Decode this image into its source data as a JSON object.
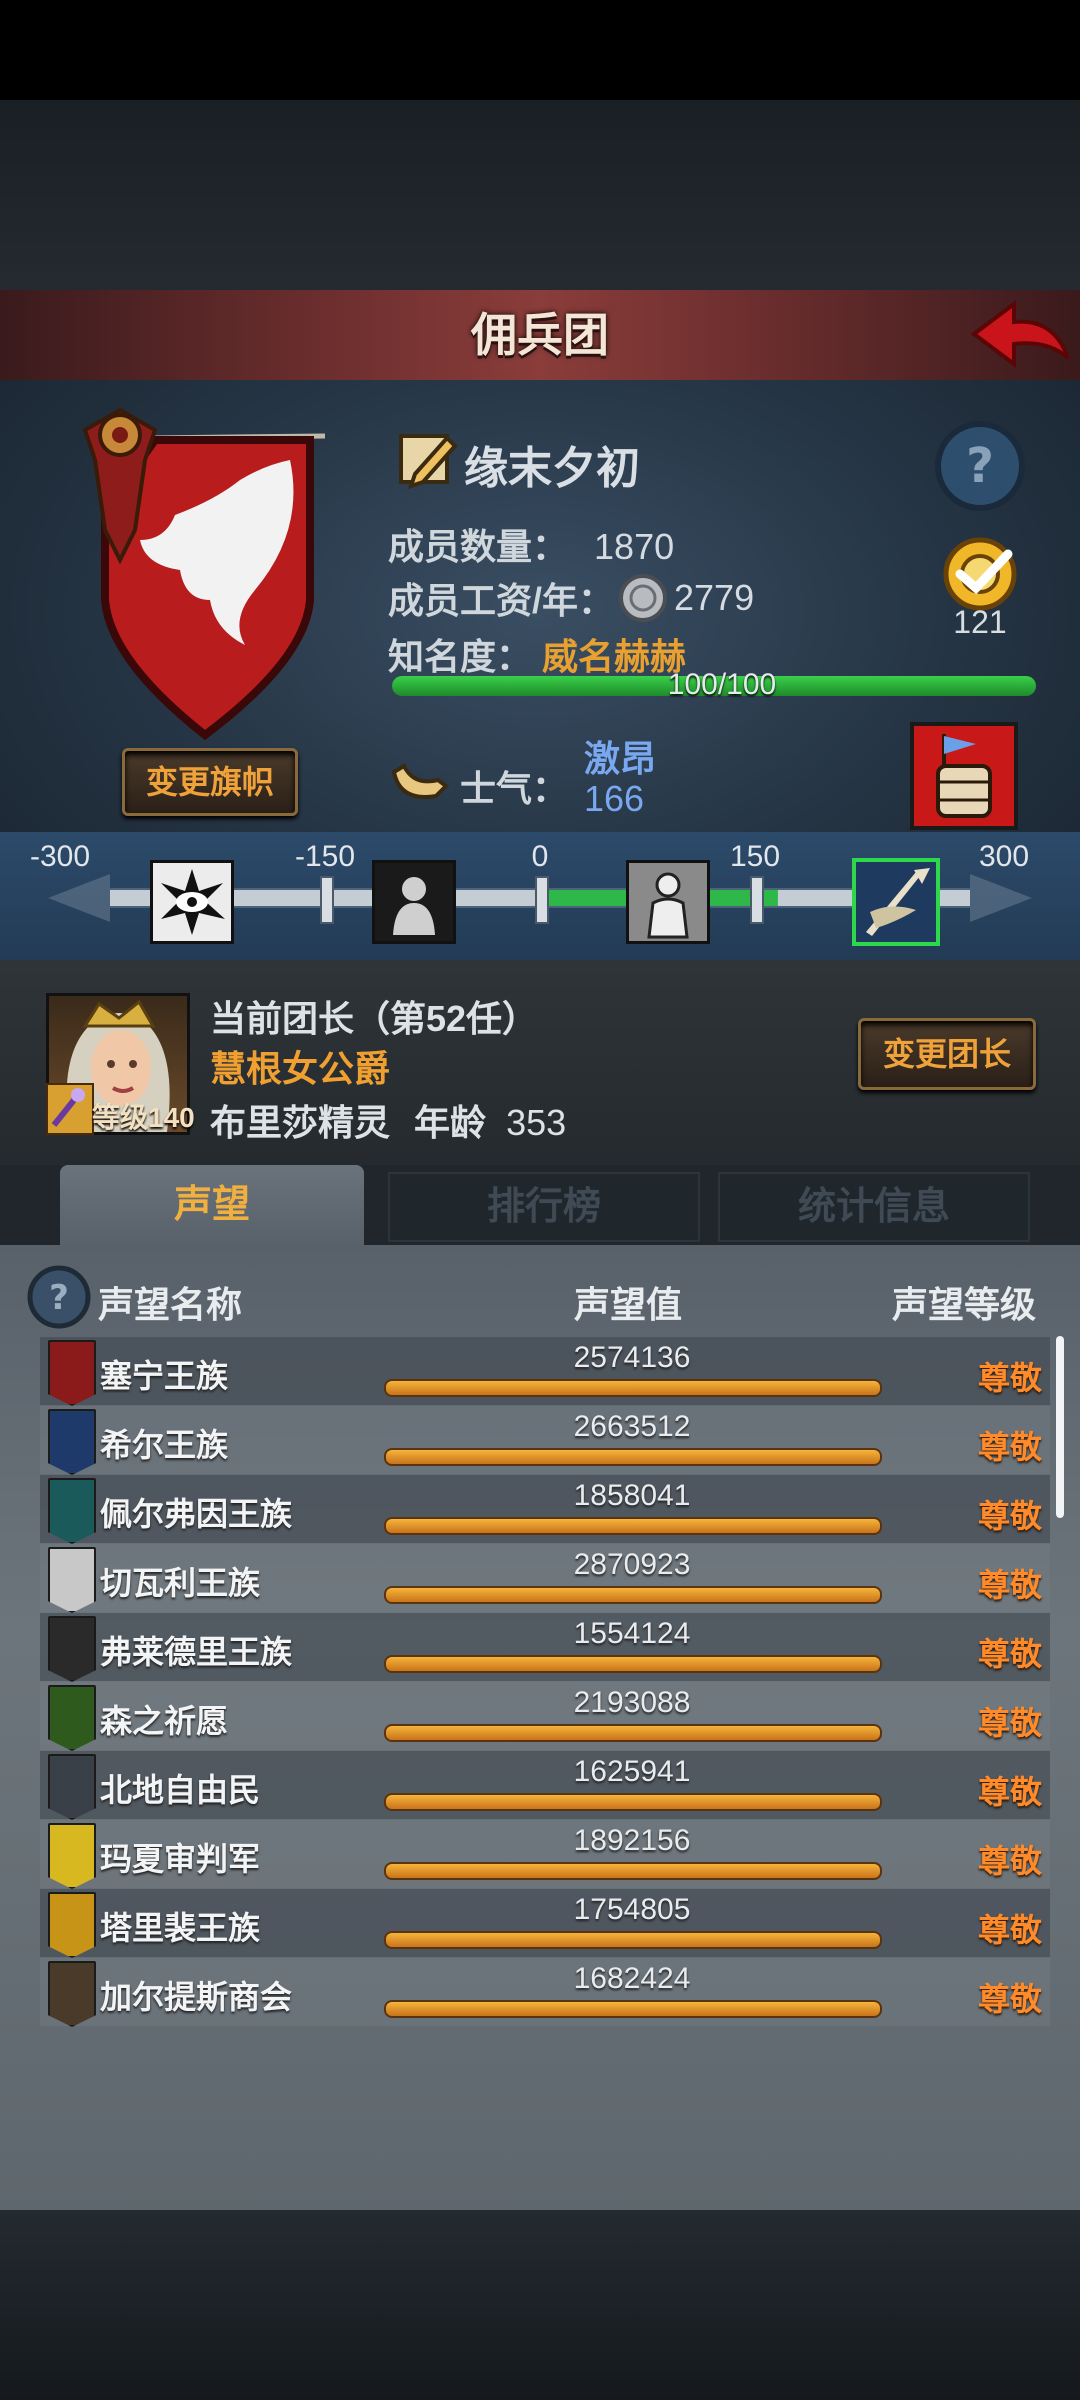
{
  "header": {
    "title": "佣兵团"
  },
  "guild": {
    "name": "缘末夕初",
    "members_label": "成员数量：",
    "members": "1870",
    "salary_label": "成员工资/年：",
    "salary": "2779",
    "fame_label": "知名度：",
    "fame_value": "威名赫赫",
    "fame_progress_text": "100/100",
    "fame_progress": 1.0,
    "badge_count": "121",
    "change_banner_label": "变更旗帜",
    "morale_label": "士气：",
    "morale_status": "激昂",
    "morale_value": "166"
  },
  "morale_scale": {
    "ticks": [
      "-300",
      "-150",
      "0",
      "150",
      "300"
    ],
    "min": -300,
    "max": 300,
    "value": 166
  },
  "leader": {
    "title": "当前团长（第52任）",
    "name": "慧根女公爵",
    "level_label": "等级",
    "level": "140",
    "race": "布里莎精灵",
    "age_label": "年龄",
    "age": "353",
    "change_leader_label": "变更团长"
  },
  "tabs": [
    {
      "label": "声望",
      "active": true
    },
    {
      "label": "排行榜",
      "active": false
    },
    {
      "label": "统计信息",
      "active": false
    }
  ],
  "reputation": {
    "columns": [
      "声望名称",
      "声望值",
      "声望等级"
    ],
    "rows": [
      {
        "name": "塞宁王族",
        "value": "2574136",
        "level": "尊敬",
        "icon": "red-banner-icon",
        "color": "#8b1a1a"
      },
      {
        "name": "希尔王族",
        "value": "2663512",
        "level": "尊敬",
        "icon": "blue-banner-icon",
        "color": "#1e3a6a"
      },
      {
        "name": "佩尔弗因王族",
        "value": "1858041",
        "level": "尊敬",
        "icon": "teal-banner-icon",
        "color": "#1a5a5a"
      },
      {
        "name": "切瓦利王族",
        "value": "2870923",
        "level": "尊敬",
        "icon": "white-banner-icon",
        "color": "#c8c8c8"
      },
      {
        "name": "弗莱德里王族",
        "value": "1554124",
        "level": "尊敬",
        "icon": "dark-banner-icon",
        "color": "#2a2a2a"
      },
      {
        "name": "森之祈愿",
        "value": "2193088",
        "level": "尊敬",
        "icon": "green-banner-icon",
        "color": "#2e5a1e"
      },
      {
        "name": "北地自由民",
        "value": "1625941",
        "level": "尊敬",
        "icon": "gray-banner-icon",
        "color": "#3a4048"
      },
      {
        "name": "玛夏审判军",
        "value": "1892156",
        "level": "尊敬",
        "icon": "yellow-black-banner-icon",
        "color": "#d8b820"
      },
      {
        "name": "塔里裴王族",
        "value": "1754805",
        "level": "尊敬",
        "icon": "gold-banner-icon",
        "color": "#c89418"
      },
      {
        "name": "加尔提斯商会",
        "value": "1682424",
        "level": "尊敬",
        "icon": "chest-banner-icon",
        "color": "#4a3a2a"
      }
    ]
  }
}
